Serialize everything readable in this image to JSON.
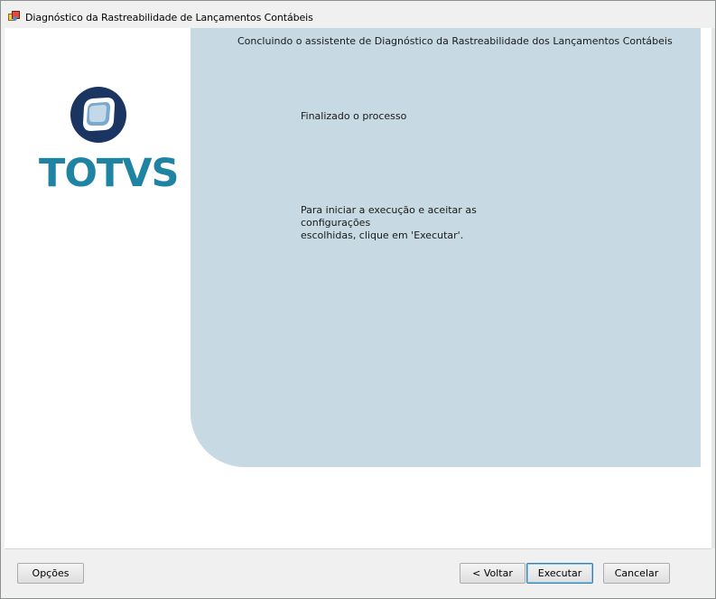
{
  "window": {
    "title": "Diagnóstico da Rastreabilidade de Lançamentos Contábeis"
  },
  "logo": {
    "brand_text": "TOTVS",
    "brand_color": "#1f84a4",
    "mark_color": "#1a3561"
  },
  "panel": {
    "heading": "Concluindo o assistente de Diagnóstico da Rastreabilidade dos Lançamentos Contábeis",
    "step_title": "Finalizado o processo",
    "instruction_line1": "Para iniciar a execução e aceitar as configurações",
    "instruction_line2": "escolhidas, clique em 'Executar'.",
    "background_color": "#c7d9e2"
  },
  "buttons": {
    "options": "Opções",
    "back": "< Voltar",
    "execute": "Executar",
    "cancel": "Cancelar"
  }
}
